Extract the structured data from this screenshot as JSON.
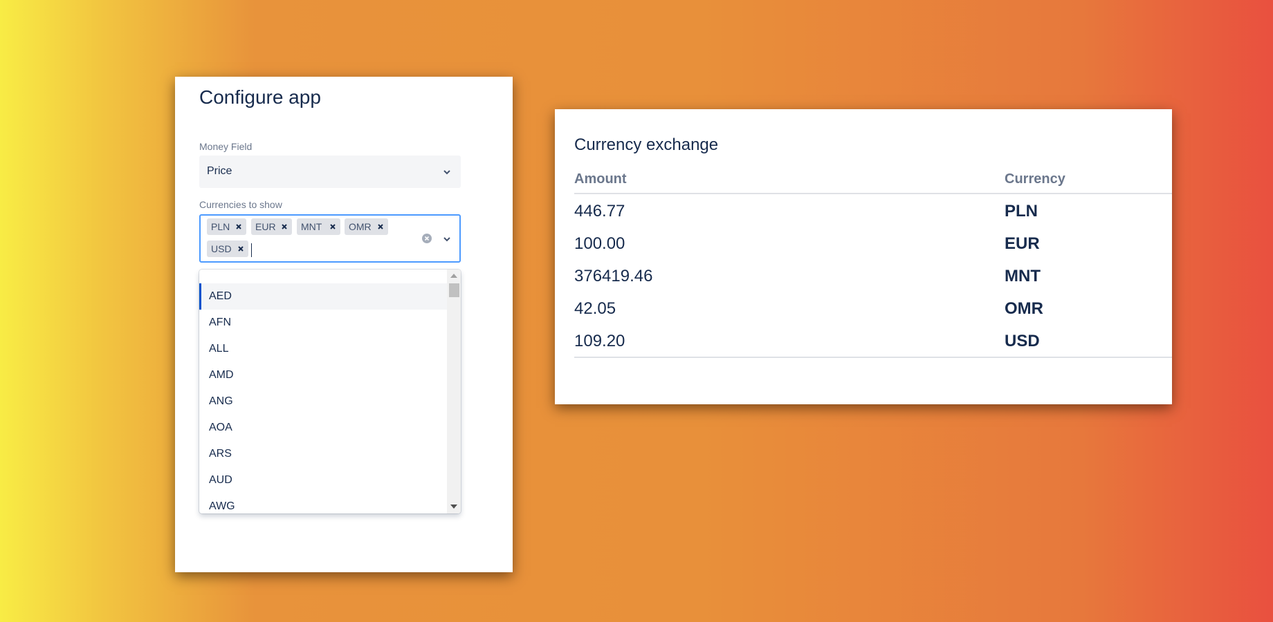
{
  "configure": {
    "title": "Configure app",
    "money_field": {
      "label": "Money Field",
      "value": "Price"
    },
    "currencies": {
      "label": "Currencies to show",
      "selected": [
        "PLN",
        "EUR",
        "MNT",
        "OMR",
        "USD"
      ],
      "input_value": ""
    },
    "dropdown_options": [
      "AED",
      "AFN",
      "ALL",
      "AMD",
      "ANG",
      "AOA",
      "ARS",
      "AUD",
      "AWG"
    ],
    "highlighted_option": "AED"
  },
  "exchange": {
    "title": "Currency exchange",
    "columns": [
      "Amount",
      "Currency"
    ],
    "rows": [
      {
        "amount": "446.77",
        "currency": "PLN"
      },
      {
        "amount": "100.00",
        "currency": "EUR"
      },
      {
        "amount": "376419.46",
        "currency": "MNT"
      },
      {
        "amount": "42.05",
        "currency": "OMR"
      },
      {
        "amount": "109.20",
        "currency": "USD"
      }
    ]
  },
  "colors": {
    "focus_border": "#4c9aff",
    "active_option_border": "#0052cc",
    "text_primary": "#172b4d",
    "text_subtle": "#6b778c",
    "tag_bg": "#dfe1e6"
  }
}
